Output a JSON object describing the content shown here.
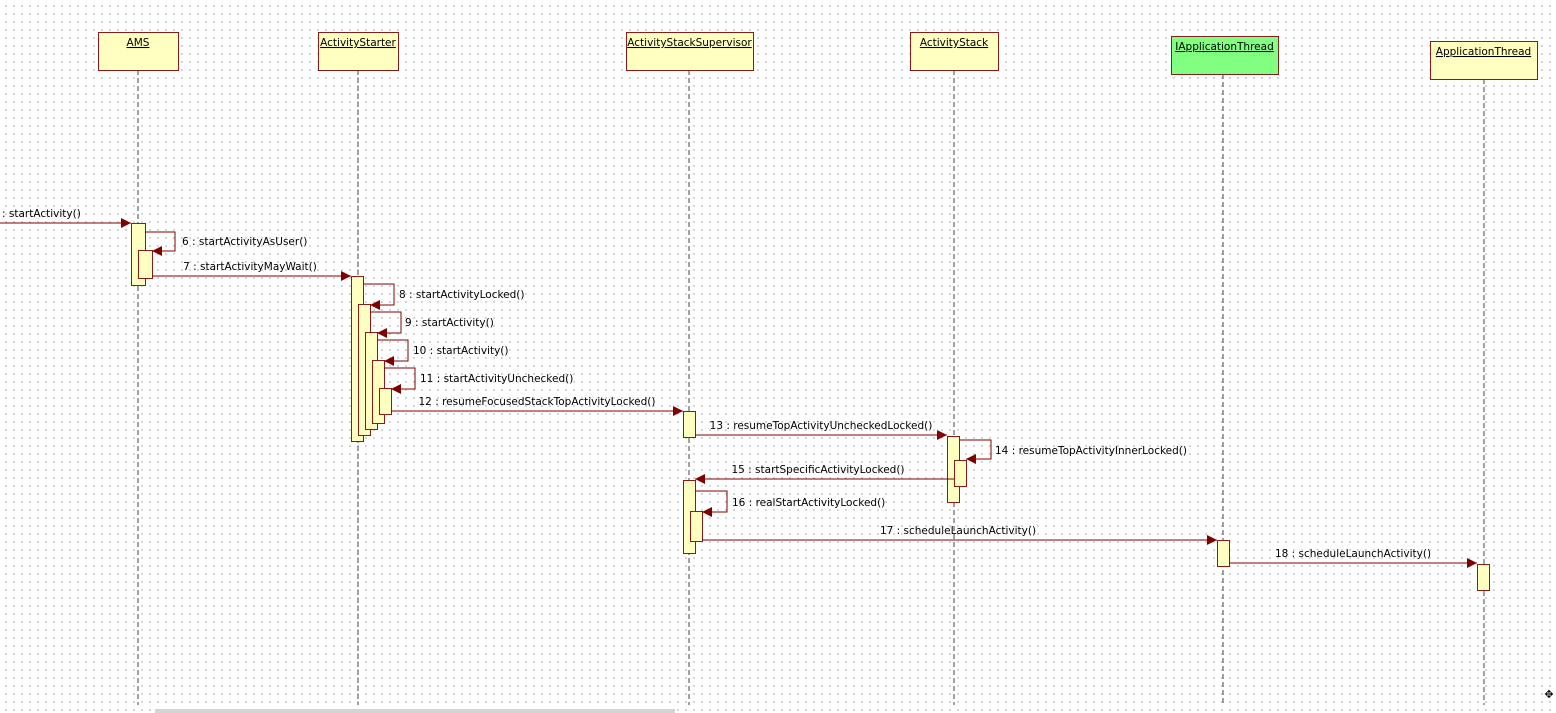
{
  "diagram": {
    "colors": {
      "box_fill": "#ffffc0",
      "box_stroke": "#8b1a1a",
      "highlight_fill": "#80ff80",
      "arrow": "#800000",
      "lifeline": "#444444"
    },
    "participants": [
      {
        "id": "ams",
        "name": "AMS",
        "highlight": false
      },
      {
        "id": "starter",
        "name": "ActivityStarter",
        "highlight": false
      },
      {
        "id": "supervisor",
        "name": "ActivityStackSupervisor",
        "highlight": false
      },
      {
        "id": "stack",
        "name": "ActivityStack",
        "highlight": false
      },
      {
        "id": "iappthread",
        "name": "IApplicationThread",
        "highlight": true
      },
      {
        "id": "appthread",
        "name": "ApplicationThread",
        "highlight": false
      }
    ],
    "messages": [
      {
        "label": ": startActivity()",
        "from": "external",
        "to": "ams"
      },
      {
        "label": "6 : startActivityAsUser()",
        "from": "ams",
        "to": "ams"
      },
      {
        "label": "7 : startActivityMayWait()",
        "from": "ams",
        "to": "starter"
      },
      {
        "label": "8 : startActivityLocked()",
        "from": "starter",
        "to": "starter"
      },
      {
        "label": "9 : startActivity()",
        "from": "starter",
        "to": "starter"
      },
      {
        "label": "10 : startActivity()",
        "from": "starter",
        "to": "starter"
      },
      {
        "label": "11 : startActivityUnchecked()",
        "from": "starter",
        "to": "starter"
      },
      {
        "label": "12 : resumeFocusedStackTopActivityLocked()",
        "from": "starter",
        "to": "supervisor"
      },
      {
        "label": "13 : resumeTopActivityUncheckedLocked()",
        "from": "supervisor",
        "to": "stack"
      },
      {
        "label": "14 : resumeTopActivityInnerLocked()",
        "from": "stack",
        "to": "stack"
      },
      {
        "label": "15 : startSpecificActivityLocked()",
        "from": "stack",
        "to": "supervisor"
      },
      {
        "label": "16 : realStartActivityLocked()",
        "from": "supervisor",
        "to": "supervisor"
      },
      {
        "label": "17 : scheduleLaunchActivity()",
        "from": "supervisor",
        "to": "iappthread"
      },
      {
        "label": "18 : scheduleLaunchActivity()",
        "from": "iappthread",
        "to": "appthread"
      }
    ]
  },
  "ui": {
    "corner_glyph": "✥"
  }
}
